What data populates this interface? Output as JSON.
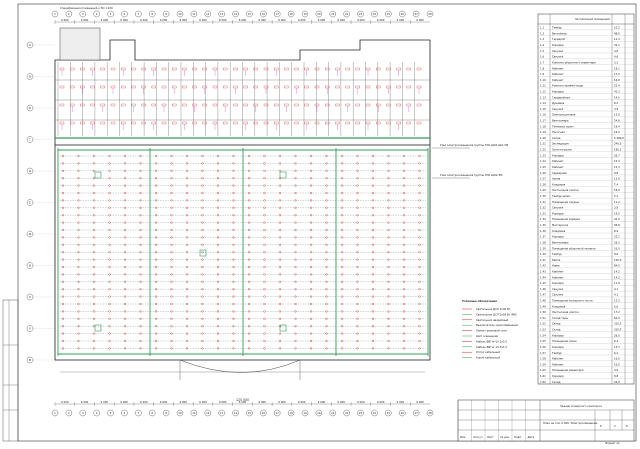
{
  "drawing": {
    "header_note": "Спецификация помещений к ЭО 1:200",
    "callout_main_1": "Узел электроосвещения группы ЭЛ1 ЩО1 ЩО-3М",
    "callout_main_2": "Узел электроосвещения группы ЭЛ2 ЩО2-3М",
    "legend_title": "Условные обозначения",
    "legend_items": [
      "Светильник ДСП 2х36 Вт",
      "Светильник ДСП 2х58 Вт IP65",
      "Светильник аварийный",
      "Выключатель одноклавишный",
      "Линия групповой сети",
      "Щит освещения",
      "Кабель ВВГнг-LS 3х2,5",
      "Кабель ВВГнг-LS 3х1,5",
      "Лоток кабельный",
      "Короб кабельный"
    ],
    "bottom_dimension": "120 000",
    "axis_top": [
      "1",
      "2",
      "3",
      "4",
      "5",
      "6",
      "7",
      "8",
      "9",
      "10",
      "11",
      "12",
      "13",
      "14",
      "15",
      "16",
      "17",
      "18",
      "19",
      "20",
      "21",
      "22",
      "23",
      "24",
      "25",
      "26",
      "27",
      "28"
    ],
    "axis_left": [
      "А",
      "Б",
      "В",
      "Г",
      "Д",
      "Е",
      "Ж",
      "И",
      "К",
      "Л",
      "М"
    ],
    "dims_top": [
      "6 000",
      "6 000",
      "6 000",
      "6 000",
      "6 000",
      "6 000",
      "6 000",
      "6 000",
      "6 000",
      "6 000",
      "6 000",
      "6 000",
      "6 000",
      "6 000",
      "6 000",
      "6 000",
      "6 000",
      "6 000",
      "6 000"
    ],
    "dims_bottom": [
      "6 000",
      "6 000",
      "6 000",
      "6 000",
      "6 000",
      "6 000",
      "6 000",
      "6 000",
      "6 000",
      "6 000",
      "6 000",
      "6 000",
      "6 000",
      "6 000",
      "6 000",
      "6 000",
      "6 000",
      "6 000",
      "6 000"
    ]
  },
  "spec_table": {
    "title": "Экспликация помещений",
    "columns": [
      "№",
      "Наименование",
      "Площадь м²",
      "Кат."
    ],
    "rows": [
      [
        "1.1",
        "Тамбур",
        "10,2",
        ""
      ],
      [
        "1.2",
        "Вестибюль",
        "48,6",
        ""
      ],
      [
        "1.3",
        "Гардероб",
        "12,4",
        ""
      ],
      [
        "1.4",
        "Коридор",
        "32,1",
        ""
      ],
      [
        "1.5",
        "Санузел",
        "4,6",
        ""
      ],
      [
        "1.6",
        "Санузел",
        "4,6",
        ""
      ],
      [
        "1.7",
        "Комната уборочного инвентаря",
        "3,2",
        ""
      ],
      [
        "1.8",
        "Кабинет",
        "18,1",
        ""
      ],
      [
        "1.9",
        "Кабинет",
        "17,9",
        ""
      ],
      [
        "1.10",
        "Кабинет",
        "16,8",
        ""
      ],
      [
        "1.11",
        "Комната приёма пищи",
        "22,4",
        ""
      ],
      [
        "1.12",
        "Коридор",
        "41,3",
        ""
      ],
      [
        "1.13",
        "Гардеробная",
        "14,5",
        ""
      ],
      [
        "1.14",
        "Душевая",
        "8,2",
        ""
      ],
      [
        "1.15",
        "Санузел",
        "3,9",
        ""
      ],
      [
        "1.16",
        "Электрощитовая",
        "12,0",
        ""
      ],
      [
        "1.17",
        "Венткамера",
        "24,6",
        ""
      ],
      [
        "1.18",
        "Тепловой пункт",
        "18,4",
        ""
      ],
      [
        "1.19",
        "Насосная",
        "16,2",
        ""
      ],
      [
        "1.20",
        "Склад",
        "6 480,0",
        ""
      ],
      [
        "1.21",
        "Экспедиция",
        "240,5",
        ""
      ],
      [
        "1.22",
        "Зона погрузки",
        "180,2",
        ""
      ],
      [
        "1.23",
        "Коридор",
        "26,7",
        ""
      ],
      [
        "1.24",
        "Кабинет",
        "15,3",
        ""
      ],
      [
        "1.25",
        "Кабинет",
        "15,3",
        ""
      ],
      [
        "1.26",
        "Серверная",
        "9,8",
        ""
      ],
      [
        "1.27",
        "Архив",
        "12,6",
        ""
      ],
      [
        "1.28",
        "Кладовая",
        "7,4",
        ""
      ],
      [
        "1.29",
        "Лестничная клетка",
        "18,9",
        ""
      ],
      [
        "1.30",
        "Тамбур-шлюз",
        "5,1",
        ""
      ],
      [
        "1.31",
        "Помещение охраны",
        "11,2",
        ""
      ],
      [
        "1.32",
        "Санузел",
        "3,8",
        ""
      ],
      [
        "1.33",
        "Коридор",
        "19,5",
        ""
      ],
      [
        "1.34",
        "Помещение зарядки",
        "42,0",
        ""
      ],
      [
        "1.35",
        "Мастерская",
        "36,8",
        ""
      ],
      [
        "1.36",
        "Кладовая",
        "8,9",
        ""
      ],
      [
        "1.37",
        "Коридор",
        "22,1",
        ""
      ],
      [
        "1.38",
        "Венткамера",
        "28,3",
        ""
      ],
      [
        "1.39",
        "Помещение уборочной техники",
        "16,5",
        ""
      ],
      [
        "1.40",
        "Тамбур",
        "9,6",
        ""
      ],
      [
        "1.41",
        "Рампа",
        "120,0",
        ""
      ],
      [
        "1.42",
        "Навес",
        "84,0",
        ""
      ],
      [
        "1.43",
        "Кабинет",
        "14,2",
        ""
      ],
      [
        "1.44",
        "Кабинет",
        "14,2",
        ""
      ],
      [
        "1.45",
        "Коридор",
        "11,8",
        ""
      ],
      [
        "1.46",
        "Санузел",
        "4,1",
        ""
      ],
      [
        "1.47",
        "Санузел",
        "4,1",
        ""
      ],
      [
        "1.48",
        "Помещение пожарного поста",
        "12,3",
        ""
      ],
      [
        "1.49",
        "Кладовая",
        "5,6",
        ""
      ],
      [
        "1.50",
        "Лестничная клетка",
        "17,2",
        ""
      ],
      [
        "1.51",
        "Склад тары",
        "64,0",
        ""
      ],
      [
        "1.52",
        "Склад",
        "310,5",
        ""
      ],
      [
        "1.53",
        "Склад",
        "310,5",
        ""
      ],
      [
        "1.54",
        "Коридор",
        "28,0",
        ""
      ],
      [
        "1.55",
        "Помещение связи",
        "6,4",
        ""
      ],
      [
        "1.56",
        "Коридор",
        "13,7",
        ""
      ],
      [
        "1.57",
        "Тамбур",
        "6,2",
        ""
      ],
      [
        "1.58",
        "Кабинет",
        "16,0",
        ""
      ],
      [
        "1.59",
        "Кабинет",
        "16,0",
        ""
      ],
      [
        "1.60",
        "Помещение инвентаря",
        "4,9",
        ""
      ],
      [
        "1.61",
        "Коридор",
        "8,8",
        ""
      ],
      [
        "1.62",
        "Склад",
        "22,0",
        ""
      ]
    ]
  },
  "title_block": {
    "project": "Здание складского комплекса",
    "sheet_title": "План на отм. 0.000. Электроосвещение.",
    "stage": "Р",
    "sheet": "3",
    "sheets": "8",
    "format": "Формат А1",
    "labels": [
      "Изм.",
      "Кол.уч",
      "Лист",
      "№ док.",
      "Подп.",
      "Дата"
    ]
  },
  "colors": {
    "grid_green": "#2f9e5a",
    "lamp_red": "#d22020",
    "label_magenta": "#c000c0",
    "label_blue": "#1a3fd0",
    "line_black": "#222222"
  }
}
